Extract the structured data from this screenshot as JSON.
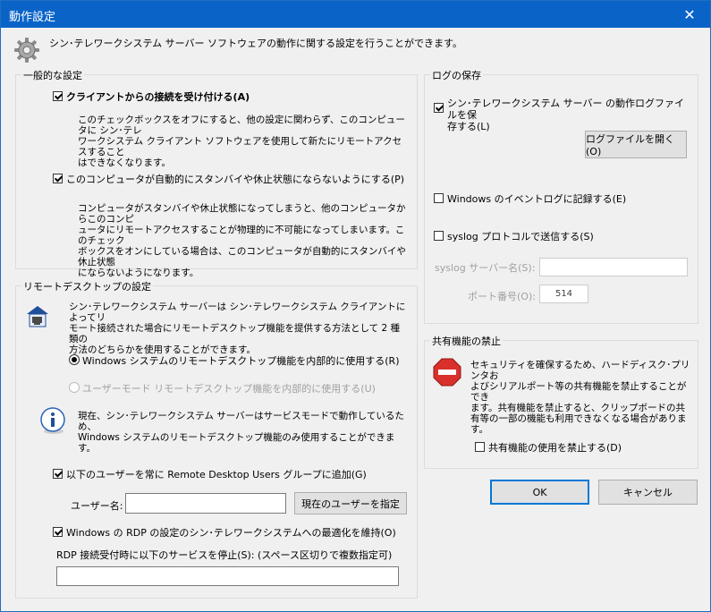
{
  "window": {
    "title": "動作設定",
    "close_glyph": "✕",
    "description": "シン･テレワークシステム サーバー ソフトウェアの動作に関する設定を行うことができます。"
  },
  "general": {
    "legend": "一般的な設定",
    "accept_checkbox": {
      "label": "クライアントからの接続を受け付ける(A)",
      "checked": true
    },
    "accept_desc": "このチェックボックスをオフにすると、他の設定に関わらず、このコンピュータに シン･テレ\nワークシステム クライアント ソフトウェアを使用して新たにリモートアクセスすること\nはできなくなります。",
    "standby_checkbox": {
      "label": "このコンピュータが自動的にスタンバイや休止状態にならないようにする(P)",
      "checked": true
    },
    "standby_desc": "コンピュータがスタンバイや休止状態になってしまうと、他のコンピュータからこのコンピ\nュータにリモートアクセスすることが物理的に不可能になってしまいます。このチェック\nボックスをオンにしている場合は、このコンピュータが自動的にスタンバイや休止状態\nにならないようになります。"
  },
  "remote": {
    "legend": "リモートデスクトップの設定",
    "desc": "シン･テレワークシステム サーバーは シン･テレワークシステム クライアントによってリ\nモート接続された場合にリモートデスクトップ機能を提供する方法として 2 種類の\n方法のどちらかを使用することができます。",
    "radio_windows": {
      "label": "Windows システムのリモートデスクトップ機能を内部的に使用する(R)",
      "checked": true
    },
    "radio_usermode": {
      "label": "ユーザーモード リモートデスクトップ機能を内部的に使用する(U)",
      "checked": false
    },
    "info_text": "現在、シン･テレワークシステム サーバーはサービスモードで動作しているため、\nWindows システムのリモートデスクトップ機能のみ使用することができます。",
    "users_group_checkbox": {
      "label": "以下のユーザーを常に Remote Desktop Users グループに追加(G)",
      "checked": true
    },
    "username_label": "ユーザー名:",
    "username_value": "",
    "current_user_button": "現在のユーザーを指定",
    "rdp_checkbox": {
      "label": "Windows の RDP の設定のシン･テレワークシステムへの最適化を維持(O)",
      "checked": true
    },
    "stop_services_label": "RDP 接続受付時に以下のサービスを停止(S): (スペース区切りで複数指定可)",
    "stop_services_value": ""
  },
  "log": {
    "legend": "ログの保存",
    "log_file_checkbox": {
      "label": "シン･テレワークシステム サーバー の動作ログファイルを保\n存する(L)",
      "checked": true
    },
    "open_log_button": "ログファイルを開く(O)",
    "eventlog_checkbox": {
      "label": "Windows のイベントログに記録する(E)",
      "checked": false
    },
    "syslog_checkbox": {
      "label": "syslog プロトコルで送信する(S)",
      "checked": false
    },
    "syslog_server_label": "syslog サーバー名(S):",
    "syslog_server_value": "",
    "port_label": "ポート番号(O):",
    "port_value": "514"
  },
  "share": {
    "legend": "共有機能の禁止",
    "desc": "セキュリティを確保するため、ハードディスク･プリンタお\nよびシリアルポート等の共有機能を禁止することができ\nます。共有機能を禁止すると、クリップボードの共\n有等の一部の機能も利用できなくなる場合があります。",
    "disable_checkbox": {
      "label": "共有機能の使用を禁止する(D)",
      "checked": false
    }
  },
  "buttons": {
    "ok": "OK",
    "cancel": "キャンセル"
  }
}
